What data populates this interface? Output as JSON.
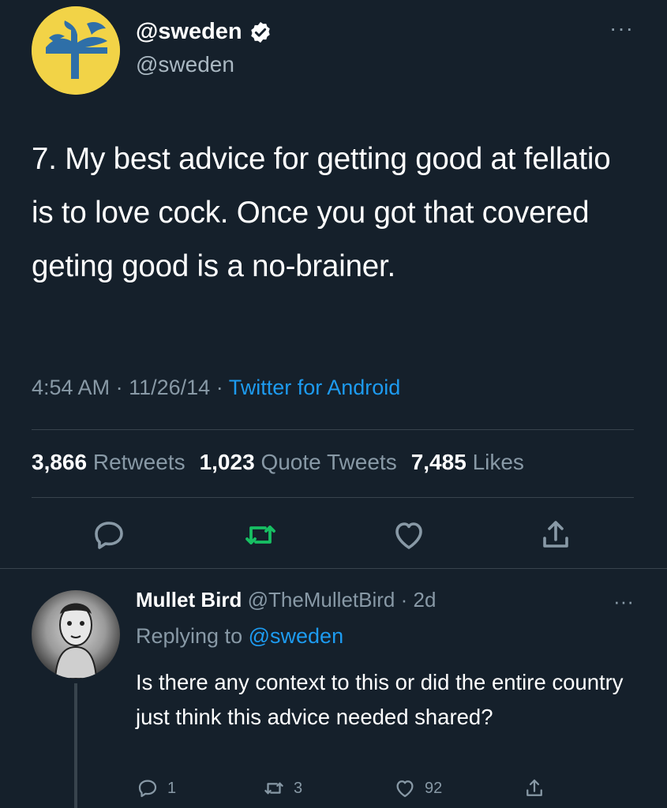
{
  "tweet": {
    "display_name": "@sweden",
    "handle": "@sweden",
    "text": "7. My best advice for getting good at fellatio is to love cock. Once you got that covered geting good is a no-brainer.",
    "time": "4:54 AM",
    "date": "11/26/14",
    "source": "Twitter for Android",
    "separator": "·",
    "stats": {
      "retweets_count": "3,866",
      "retweets_label": "Retweets",
      "quotes_count": "1,023",
      "quotes_label": "Quote Tweets",
      "likes_count": "7,485",
      "likes_label": "Likes"
    },
    "more": "···"
  },
  "reply": {
    "display_name": "Mullet Bird",
    "handle": "@TheMulletBird",
    "separator": "·",
    "age": "2d",
    "replying_prefix": "Replying to",
    "replying_to": "@sweden",
    "text": "Is there any context to this or did the entire country just think this advice needed shared?",
    "reply_count": "1",
    "retweet_count": "3",
    "like_count": "92",
    "more": "···"
  },
  "colors": {
    "background": "#15202b",
    "accent_blue": "#1d9bf0",
    "retweet_green": "#17bf63",
    "muted": "#8899a6",
    "sweden_yellow": "#f2d347",
    "sweden_blue": "#2e6fa8"
  },
  "icons": [
    "verified-badge-icon",
    "reply-icon",
    "retweet-icon",
    "like-icon",
    "share-icon",
    "more-icon"
  ]
}
